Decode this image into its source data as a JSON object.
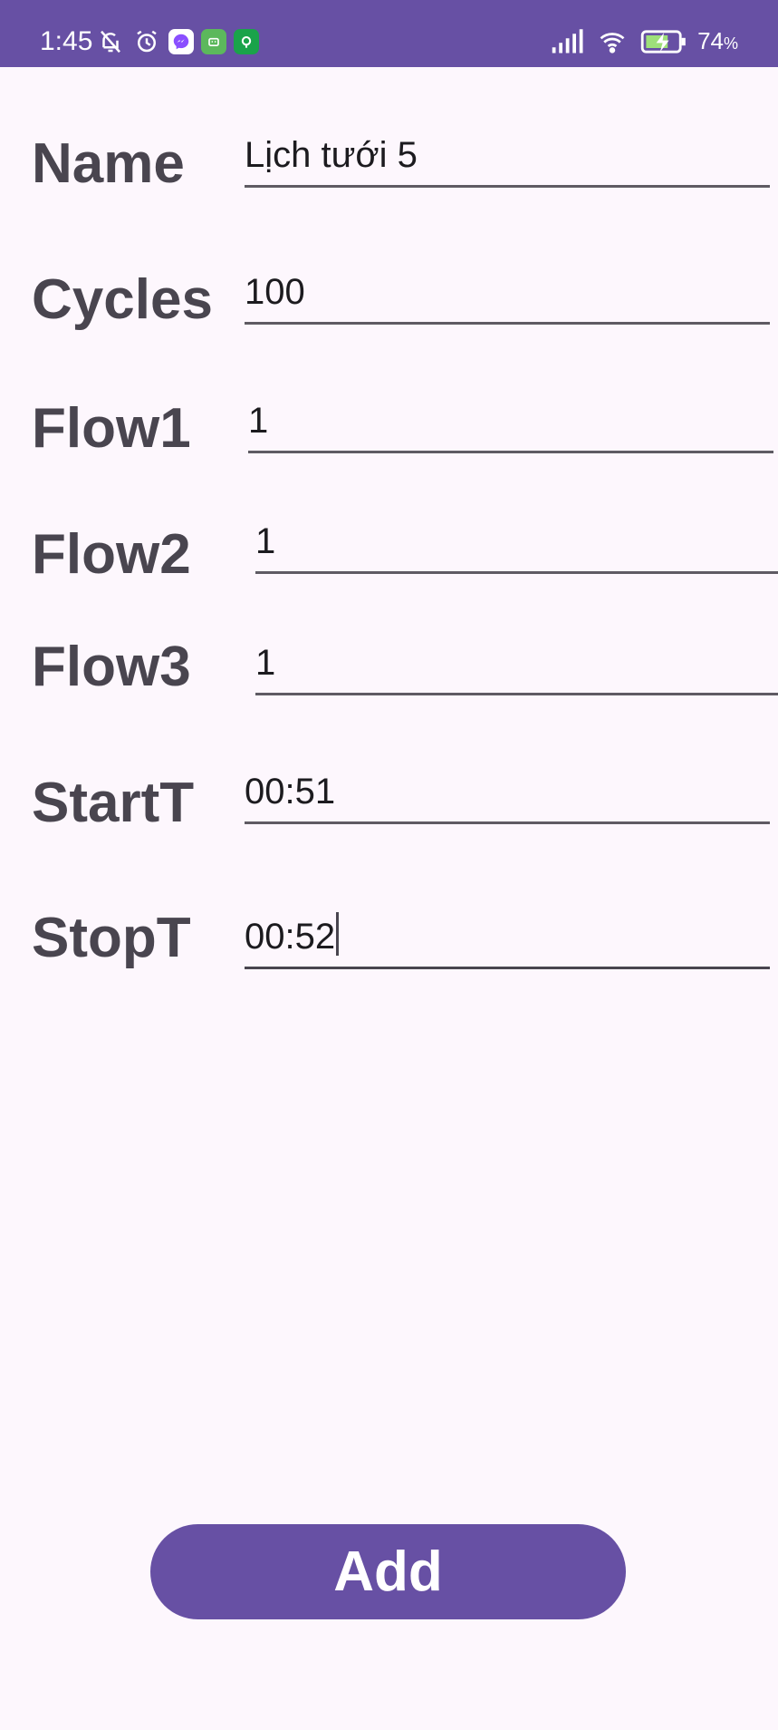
{
  "status_bar": {
    "time": "1:45",
    "battery_level": "74",
    "battery_unit": "%",
    "left_icons": [
      "bell-off-icon",
      "alarm-icon",
      "messenger-icon",
      "android-app-icon",
      "green-app-icon"
    ],
    "right_icons": [
      "signal-icon",
      "wifi-icon",
      "battery-charging-icon"
    ],
    "color": "#6750a4"
  },
  "form": {
    "fields": [
      {
        "label": "Name",
        "value": "Lịch tưới 5"
      },
      {
        "label": "Cycles",
        "value": "100"
      },
      {
        "label": "Flow1",
        "value": "1"
      },
      {
        "label": "Flow2",
        "value": "1"
      },
      {
        "label": "Flow3",
        "value": "1"
      },
      {
        "label": "StartT",
        "value": "00:51"
      },
      {
        "label": "StopT",
        "value": "00:52",
        "focused": true
      }
    ]
  },
  "add_button": {
    "label": "Add",
    "color": "#6750a4"
  }
}
